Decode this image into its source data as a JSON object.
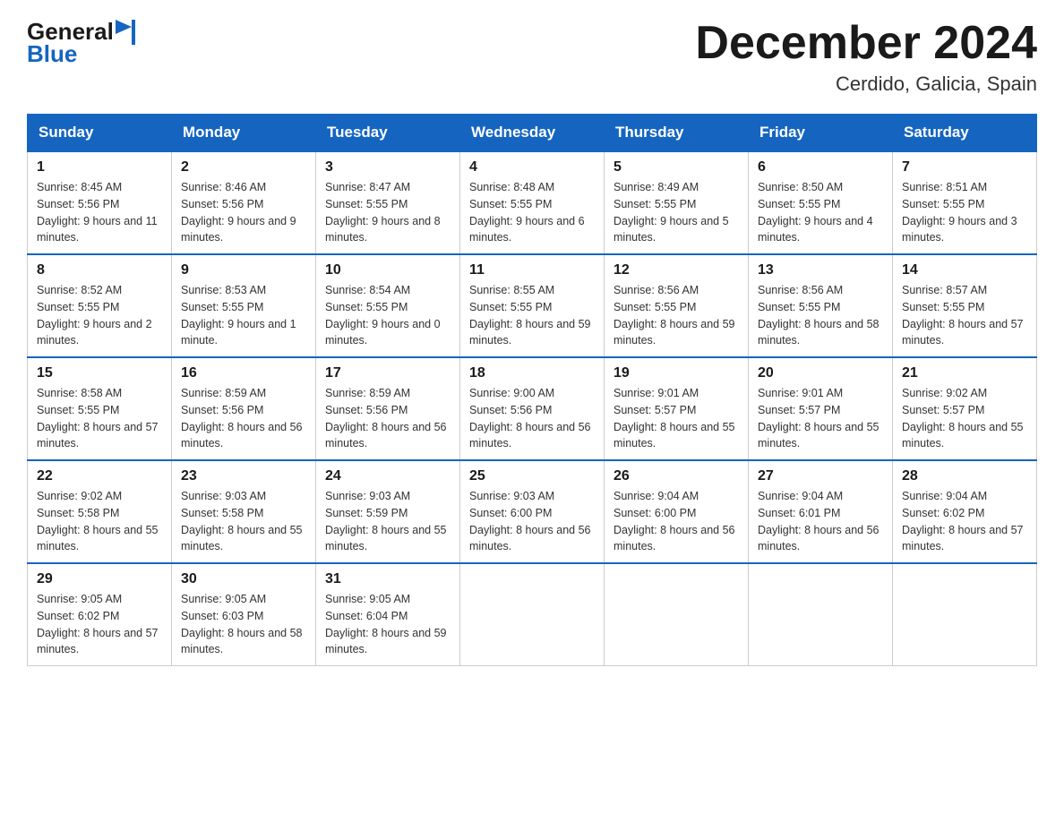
{
  "logo": {
    "general": "General",
    "blue": "Blue"
  },
  "title": "December 2024",
  "location": "Cerdido, Galicia, Spain",
  "days_of_week": [
    "Sunday",
    "Monday",
    "Tuesday",
    "Wednesday",
    "Thursday",
    "Friday",
    "Saturday"
  ],
  "weeks": [
    [
      {
        "day": "1",
        "sunrise": "Sunrise: 8:45 AM",
        "sunset": "Sunset: 5:56 PM",
        "daylight": "Daylight: 9 hours and 11 minutes."
      },
      {
        "day": "2",
        "sunrise": "Sunrise: 8:46 AM",
        "sunset": "Sunset: 5:56 PM",
        "daylight": "Daylight: 9 hours and 9 minutes."
      },
      {
        "day": "3",
        "sunrise": "Sunrise: 8:47 AM",
        "sunset": "Sunset: 5:55 PM",
        "daylight": "Daylight: 9 hours and 8 minutes."
      },
      {
        "day": "4",
        "sunrise": "Sunrise: 8:48 AM",
        "sunset": "Sunset: 5:55 PM",
        "daylight": "Daylight: 9 hours and 6 minutes."
      },
      {
        "day": "5",
        "sunrise": "Sunrise: 8:49 AM",
        "sunset": "Sunset: 5:55 PM",
        "daylight": "Daylight: 9 hours and 5 minutes."
      },
      {
        "day": "6",
        "sunrise": "Sunrise: 8:50 AM",
        "sunset": "Sunset: 5:55 PM",
        "daylight": "Daylight: 9 hours and 4 minutes."
      },
      {
        "day": "7",
        "sunrise": "Sunrise: 8:51 AM",
        "sunset": "Sunset: 5:55 PM",
        "daylight": "Daylight: 9 hours and 3 minutes."
      }
    ],
    [
      {
        "day": "8",
        "sunrise": "Sunrise: 8:52 AM",
        "sunset": "Sunset: 5:55 PM",
        "daylight": "Daylight: 9 hours and 2 minutes."
      },
      {
        "day": "9",
        "sunrise": "Sunrise: 8:53 AM",
        "sunset": "Sunset: 5:55 PM",
        "daylight": "Daylight: 9 hours and 1 minute."
      },
      {
        "day": "10",
        "sunrise": "Sunrise: 8:54 AM",
        "sunset": "Sunset: 5:55 PM",
        "daylight": "Daylight: 9 hours and 0 minutes."
      },
      {
        "day": "11",
        "sunrise": "Sunrise: 8:55 AM",
        "sunset": "Sunset: 5:55 PM",
        "daylight": "Daylight: 8 hours and 59 minutes."
      },
      {
        "day": "12",
        "sunrise": "Sunrise: 8:56 AM",
        "sunset": "Sunset: 5:55 PM",
        "daylight": "Daylight: 8 hours and 59 minutes."
      },
      {
        "day": "13",
        "sunrise": "Sunrise: 8:56 AM",
        "sunset": "Sunset: 5:55 PM",
        "daylight": "Daylight: 8 hours and 58 minutes."
      },
      {
        "day": "14",
        "sunrise": "Sunrise: 8:57 AM",
        "sunset": "Sunset: 5:55 PM",
        "daylight": "Daylight: 8 hours and 57 minutes."
      }
    ],
    [
      {
        "day": "15",
        "sunrise": "Sunrise: 8:58 AM",
        "sunset": "Sunset: 5:55 PM",
        "daylight": "Daylight: 8 hours and 57 minutes."
      },
      {
        "day": "16",
        "sunrise": "Sunrise: 8:59 AM",
        "sunset": "Sunset: 5:56 PM",
        "daylight": "Daylight: 8 hours and 56 minutes."
      },
      {
        "day": "17",
        "sunrise": "Sunrise: 8:59 AM",
        "sunset": "Sunset: 5:56 PM",
        "daylight": "Daylight: 8 hours and 56 minutes."
      },
      {
        "day": "18",
        "sunrise": "Sunrise: 9:00 AM",
        "sunset": "Sunset: 5:56 PM",
        "daylight": "Daylight: 8 hours and 56 minutes."
      },
      {
        "day": "19",
        "sunrise": "Sunrise: 9:01 AM",
        "sunset": "Sunset: 5:57 PM",
        "daylight": "Daylight: 8 hours and 55 minutes."
      },
      {
        "day": "20",
        "sunrise": "Sunrise: 9:01 AM",
        "sunset": "Sunset: 5:57 PM",
        "daylight": "Daylight: 8 hours and 55 minutes."
      },
      {
        "day": "21",
        "sunrise": "Sunrise: 9:02 AM",
        "sunset": "Sunset: 5:57 PM",
        "daylight": "Daylight: 8 hours and 55 minutes."
      }
    ],
    [
      {
        "day": "22",
        "sunrise": "Sunrise: 9:02 AM",
        "sunset": "Sunset: 5:58 PM",
        "daylight": "Daylight: 8 hours and 55 minutes."
      },
      {
        "day": "23",
        "sunrise": "Sunrise: 9:03 AM",
        "sunset": "Sunset: 5:58 PM",
        "daylight": "Daylight: 8 hours and 55 minutes."
      },
      {
        "day": "24",
        "sunrise": "Sunrise: 9:03 AM",
        "sunset": "Sunset: 5:59 PM",
        "daylight": "Daylight: 8 hours and 55 minutes."
      },
      {
        "day": "25",
        "sunrise": "Sunrise: 9:03 AM",
        "sunset": "Sunset: 6:00 PM",
        "daylight": "Daylight: 8 hours and 56 minutes."
      },
      {
        "day": "26",
        "sunrise": "Sunrise: 9:04 AM",
        "sunset": "Sunset: 6:00 PM",
        "daylight": "Daylight: 8 hours and 56 minutes."
      },
      {
        "day": "27",
        "sunrise": "Sunrise: 9:04 AM",
        "sunset": "Sunset: 6:01 PM",
        "daylight": "Daylight: 8 hours and 56 minutes."
      },
      {
        "day": "28",
        "sunrise": "Sunrise: 9:04 AM",
        "sunset": "Sunset: 6:02 PM",
        "daylight": "Daylight: 8 hours and 57 minutes."
      }
    ],
    [
      {
        "day": "29",
        "sunrise": "Sunrise: 9:05 AM",
        "sunset": "Sunset: 6:02 PM",
        "daylight": "Daylight: 8 hours and 57 minutes."
      },
      {
        "day": "30",
        "sunrise": "Sunrise: 9:05 AM",
        "sunset": "Sunset: 6:03 PM",
        "daylight": "Daylight: 8 hours and 58 minutes."
      },
      {
        "day": "31",
        "sunrise": "Sunrise: 9:05 AM",
        "sunset": "Sunset: 6:04 PM",
        "daylight": "Daylight: 8 hours and 59 minutes."
      },
      null,
      null,
      null,
      null
    ]
  ]
}
